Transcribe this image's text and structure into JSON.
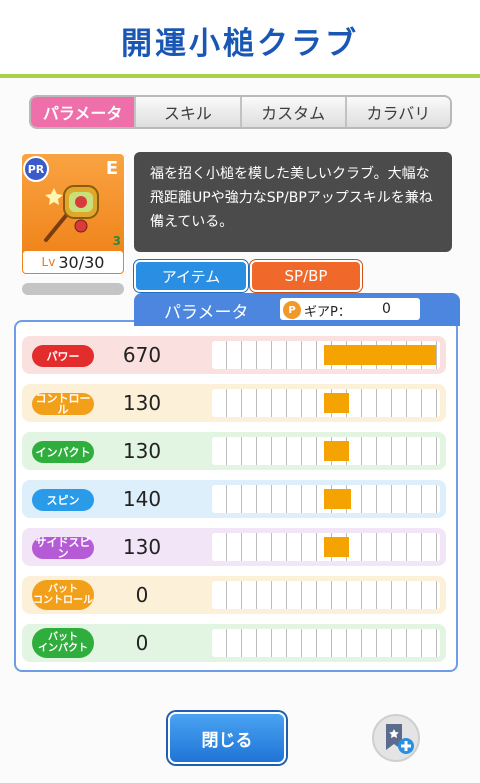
{
  "header": {
    "title": "開運小槌クラブ"
  },
  "tabs": [
    {
      "label": "パラメータ",
      "active": true
    },
    {
      "label": "スキル",
      "active": false
    },
    {
      "label": "カスタム",
      "active": false
    },
    {
      "label": "カラバリ",
      "active": false
    }
  ],
  "item": {
    "rarity_badge": "PR",
    "rank": "E",
    "level_prefix": "Lv",
    "level": "30/30",
    "leaf_count": "3"
  },
  "description": "福を招く小槌を模した美しいクラブ。大幅な飛距離UPや強力なSP/BPアップスキルを兼ね備えている。",
  "buttons": {
    "item": "アイテム",
    "spbp": "SP/BP",
    "close": "閉じる"
  },
  "panel": {
    "title": "パラメータ",
    "gear_icon_text": "P",
    "gear_label": "ギアP：",
    "gear_value": "0"
  },
  "stats": [
    {
      "label": "パワー",
      "value": "670",
      "fill_fraction": 1.0,
      "color": "#e32c2c",
      "row_bg": "#fbe0e0"
    },
    {
      "label": "コントロール",
      "value": "130",
      "fill_fraction": 0.22,
      "color": "#f2a01a",
      "row_bg": "#fdf0d8"
    },
    {
      "label": "インパクト",
      "value": "130",
      "fill_fraction": 0.22,
      "color": "#2fae3e",
      "row_bg": "#e2f4e2"
    },
    {
      "label": "スピン",
      "value": "140",
      "fill_fraction": 0.24,
      "color": "#2a9be8",
      "row_bg": "#ddeffb"
    },
    {
      "label": "サイドスピン",
      "value": "130",
      "fill_fraction": 0.22,
      "color": "#b65bd6",
      "row_bg": "#f3e5f8"
    },
    {
      "label": "バット コントロール",
      "value": "0",
      "fill_fraction": 0,
      "color": "#f2a01a",
      "row_bg": "#fdf0d8"
    },
    {
      "label": "バット インパクト",
      "value": "0",
      "fill_fraction": 0,
      "color": "#2fae3e",
      "row_bg": "#e2f4e2"
    }
  ],
  "colors": {
    "accent_blue": "#1a57b5",
    "tab_active": "#ee6fa9",
    "bar_fill": "#f5a300"
  }
}
